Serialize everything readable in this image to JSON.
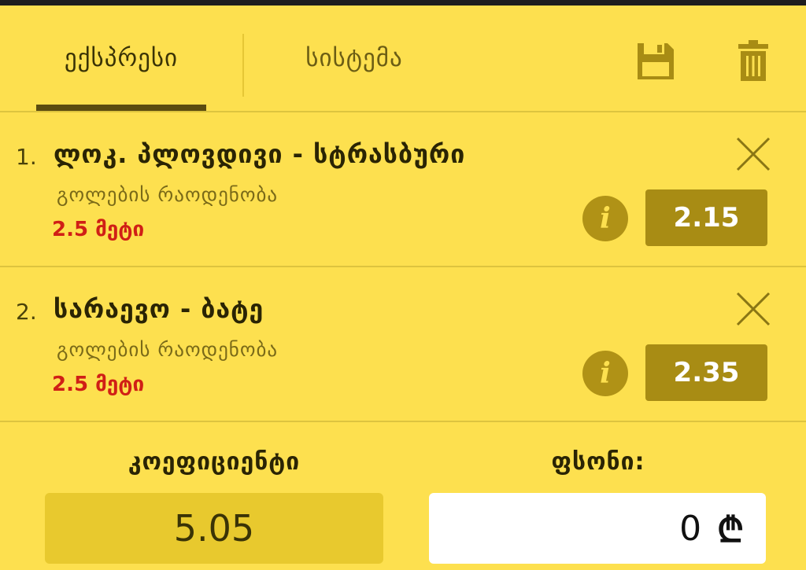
{
  "tabs": {
    "express_label": "ექსპრესი",
    "system_label": "სისტემა"
  },
  "bets": [
    {
      "number": "1.",
      "title": "ლოკ. პლოვდივი - სტრასბური",
      "market": "გოლების რაოდენობა",
      "pick": "2.5 მეტი",
      "odds": "2.15"
    },
    {
      "number": "2.",
      "title": "სარაევო - ბატე",
      "market": "გოლების რაოდენობა",
      "pick": "2.5 მეტი",
      "odds": "2.35"
    }
  ],
  "summary": {
    "coefficient_label": "კოეფიციენტი",
    "coefficient_value": "5.05",
    "stake_label": "ფსონი:",
    "stake_value": "0",
    "currency_symbol": "₾"
  },
  "info_glyph": "i",
  "icons": {
    "save": "save-icon",
    "trash": "trash-icon",
    "close": "close-icon",
    "info": "info-icon"
  },
  "colors": {
    "background": "#fde04f",
    "odds_box": "#a88c14",
    "pick_text": "#d01f16",
    "accent_dark": "#5b4c10"
  }
}
